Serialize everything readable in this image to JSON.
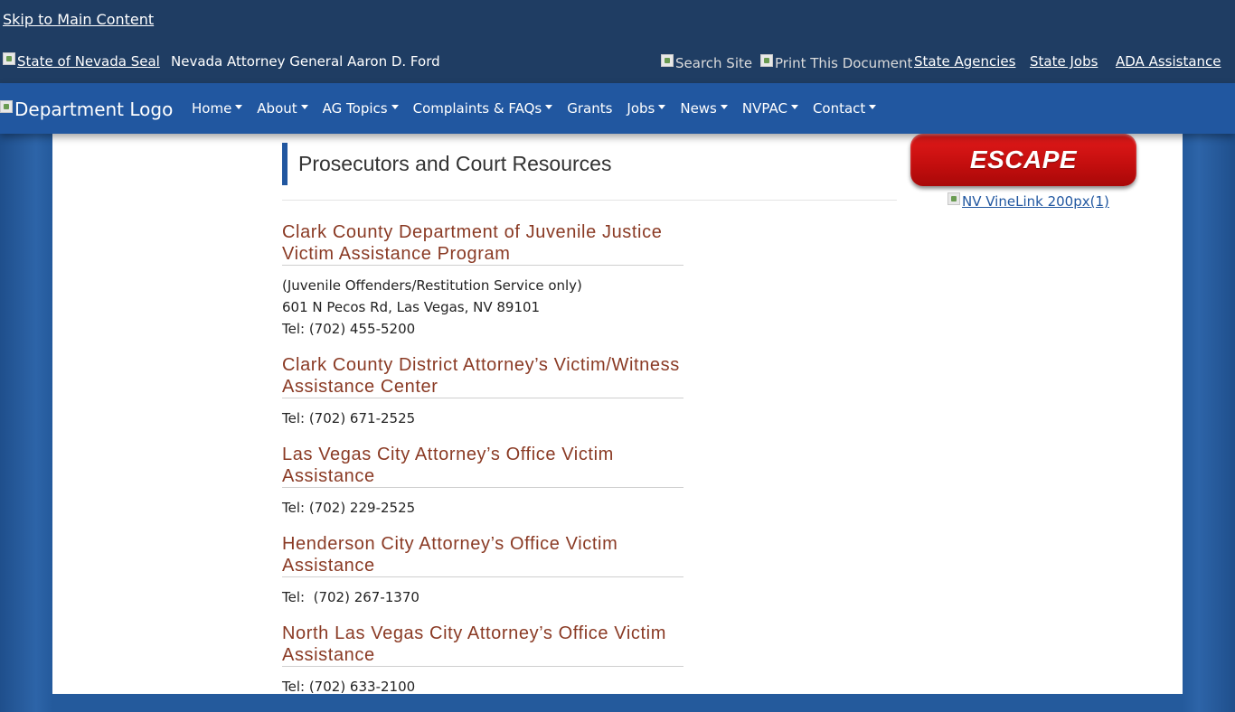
{
  "topbar": {
    "skip_link": "Skip to Main Content",
    "seal_alt": "State of Nevada Seal",
    "agency_name": "Nevada Attorney General Aaron D. Ford",
    "search_alt": "Search Site",
    "print_alt": "Print This Document",
    "links": [
      "State Agencies",
      "State Jobs",
      "ADA Assistance"
    ]
  },
  "navbar": {
    "logo_alt": "Department Logo",
    "items": [
      {
        "label": "Home",
        "dropdown": true
      },
      {
        "label": "About",
        "dropdown": true
      },
      {
        "label": "AG Topics",
        "dropdown": true
      },
      {
        "label": "Complaints & FAQs",
        "dropdown": true
      },
      {
        "label": "Grants",
        "dropdown": false
      },
      {
        "label": "Jobs",
        "dropdown": true
      },
      {
        "label": "News",
        "dropdown": true
      },
      {
        "label": "NVPAC",
        "dropdown": true
      },
      {
        "label": "Contact",
        "dropdown": true
      }
    ]
  },
  "main": {
    "page_title": "Prosecutors and Court Resources",
    "entries": [
      {
        "title": "Clark County Department of Juvenile Justice Victim Assistance Program",
        "lines": [
          "(Juvenile Offenders/Restitution Service only)",
          "601 N Pecos Rd, Las Vegas, NV 89101",
          "Tel: (702) 455-5200"
        ]
      },
      {
        "title": "Clark County District Attorney’s Victim/Witness Assistance Center",
        "lines": [
          "Tel: (702) 671-2525"
        ]
      },
      {
        "title": "Las Vegas City Attorney’s Office Victim Assistance",
        "lines": [
          "Tel: (702) 229-2525"
        ]
      },
      {
        "title": "Henderson City Attorney’s Office Victim Assistance",
        "lines": [
          "Tel:  (702) 267-1370"
        ]
      },
      {
        "title": "North Las Vegas City Attorney’s Office Victim Assistance",
        "lines": [
          "Tel: (702) 633-2100"
        ]
      }
    ]
  },
  "sidebar": {
    "escape_label": "ESCAPE",
    "vinelink_alt": "NV VineLink 200px(1)"
  },
  "colors": {
    "topbar": "#1f3d63",
    "navbar": "#2157a0",
    "entry_title": "#8a3a24",
    "escape_red": "#d01414"
  }
}
